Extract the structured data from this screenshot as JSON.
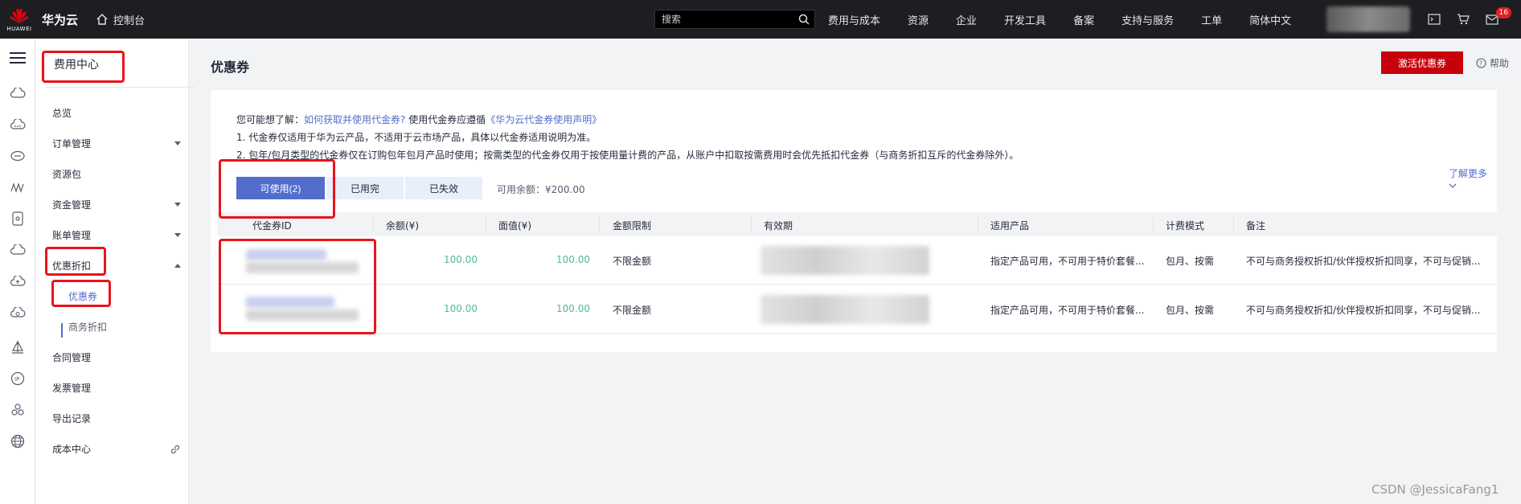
{
  "brand": {
    "logo_text": "HUAWEI",
    "name": "华为云",
    "console": "控制台"
  },
  "search": {
    "placeholder": "搜索"
  },
  "nav": [
    "费用与成本",
    "资源",
    "企业",
    "开发工具",
    "备案",
    "支持与服务",
    "工单",
    "简体中文"
  ],
  "notification_count": "16",
  "sidebar": {
    "title": "费用中心",
    "items": [
      {
        "label": "总览",
        "expandable": false
      },
      {
        "label": "订单管理",
        "expandable": true
      },
      {
        "label": "资源包",
        "expandable": false
      },
      {
        "label": "资金管理",
        "expandable": true
      },
      {
        "label": "账单管理",
        "expandable": true
      },
      {
        "label": "优惠折扣",
        "expandable": true,
        "expanded": true
      },
      {
        "label": "合同管理",
        "expandable": false
      },
      {
        "label": "发票管理",
        "expandable": false
      },
      {
        "label": "导出记录",
        "expandable": false
      },
      {
        "label": "成本中心",
        "expandable": false
      }
    ],
    "sub_items": [
      {
        "label": "优惠券",
        "active": true
      },
      {
        "label": "商务折扣",
        "active": false
      }
    ]
  },
  "page": {
    "title": "优惠券",
    "activate_button": "激活优惠券",
    "help": "帮助"
  },
  "info": {
    "prefix": "您可能想了解：",
    "link1": "如何获取并使用代金券?",
    "mid": " 使用代金券应遵循",
    "link2": "《华为云代金券使用声明》",
    "line1": "1. 代金券仅适用于华为云产品，不适用于云市场产品，具体以代金券适用说明为准。",
    "line2": "2. 包年/包月类型的代金券仅在订购包年包月产品时使用；按需类型的代金券仅用于按使用量计费的产品，从账户中扣取按需费用时会优先抵扣代金券（与商务折扣互斥的代金券除外）。",
    "learn_more": "了解更多"
  },
  "tabs": [
    {
      "label": "可使用(2)",
      "active": true
    },
    {
      "label": "已用完",
      "active": false
    },
    {
      "label": "已失效",
      "active": false
    }
  ],
  "balance": "可用余额：¥200.00",
  "table": {
    "columns": [
      "代金券ID",
      "余额(¥)",
      "面值(¥)",
      "金额限制",
      "有效期",
      "适用产品",
      "计费模式",
      "备注"
    ],
    "rows": [
      {
        "balance": "100.00",
        "face_value": "100.00",
        "limit": "不限金额",
        "product": "指定产品可用，不可用于特价套餐...",
        "billing": "包月、按需",
        "remark": "不可与商务授权折扣/伙伴授权折扣同享，不可与促销..."
      },
      {
        "balance": "100.00",
        "face_value": "100.00",
        "limit": "不限金额",
        "product": "指定产品可用，不可用于特价套餐...",
        "billing": "包月、按需",
        "remark": "不可与商务授权折扣/伙伴授权折扣同享，不可与促销..."
      }
    ]
  },
  "watermark": "CSDN @JessicaFang1",
  "colors": {
    "accent": "#526ecc",
    "brand_red": "#c7000b",
    "annotation_red": "#e8141c",
    "amount_green": "#50b7a0"
  }
}
